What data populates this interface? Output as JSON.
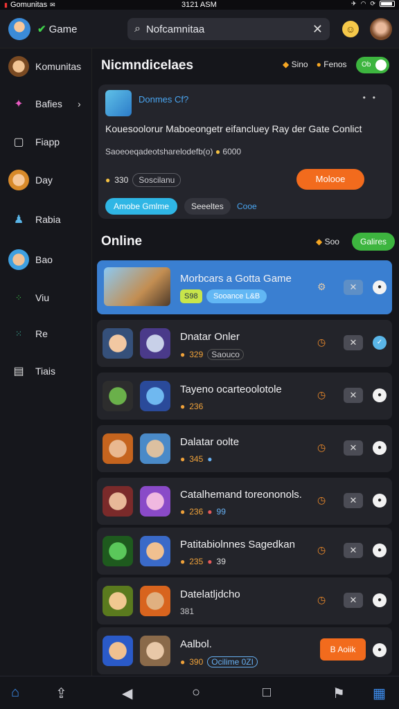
{
  "status": {
    "carrier": "Gomunitas",
    "time": "3121 ASM"
  },
  "topbar": {
    "app_title": "Game",
    "search_value": "Nofcamnitaa"
  },
  "sidebar": {
    "items": [
      {
        "label": "Komunitas",
        "icon": "avatar-icon"
      },
      {
        "label": "Bafies",
        "icon": "sparkle-icon",
        "chevron": true
      },
      {
        "label": "Fiapp",
        "icon": "square-icon"
      },
      {
        "label": "Day",
        "icon": "avatar-icon"
      },
      {
        "label": "Rabia",
        "icon": "figure-icon"
      },
      {
        "label": "Bao",
        "icon": "avatar-icon"
      },
      {
        "label": "Viu",
        "icon": "dots-icon"
      },
      {
        "label": "Re",
        "icon": "grid-icon"
      },
      {
        "label": "Tiais",
        "icon": "doc-icon"
      }
    ]
  },
  "header": {
    "title": "Nicmndicelaes",
    "link1": "Sino",
    "link2": "Fenos",
    "toggle": "Ob"
  },
  "card": {
    "title": "Donmes Cf?",
    "line1": "Kouesoolorur Maboeongetr eifancluey Ray der Gate Conlict",
    "line2": "Saoeoeqadeotsharelodefb(o)",
    "line2_coin": "6000",
    "stats": "330",
    "stats_pill": "Soscilanu",
    "cta": "Molooe",
    "tag1": "Amobe Gmlme",
    "tag2": "Seeeltes",
    "tag3": "Cooe"
  },
  "online": {
    "title": "Online",
    "link": "Soo",
    "button": "Galires"
  },
  "featured": {
    "title": "Morbcars a Gotta Game",
    "chip1": "S98",
    "chip2": "Sooance L&B"
  },
  "rows": [
    {
      "title": "Dnatar Onler",
      "num": "329",
      "pill": "Saouco",
      "extra": ""
    },
    {
      "title": "Tayeno ocarteoolotole",
      "num": "236",
      "pill": "",
      "extra": ""
    },
    {
      "title": "Dalatar oolte",
      "num": "345",
      "pill": "",
      "extra": ""
    },
    {
      "title": "Catalhemand toreononols.",
      "num": "236",
      "pill": "",
      "extra": "99"
    },
    {
      "title": "Patitabiolnnes Sagedkan",
      "num": "235",
      "pill": "",
      "extra": "39"
    },
    {
      "title": "Datelatljdcho",
      "num": "381",
      "pill": "",
      "extra": ""
    },
    {
      "title": "Aalbol.",
      "num": "390",
      "pill": "",
      "extra": "Ocilime 0ZI",
      "button": "B Aoiik"
    }
  ]
}
